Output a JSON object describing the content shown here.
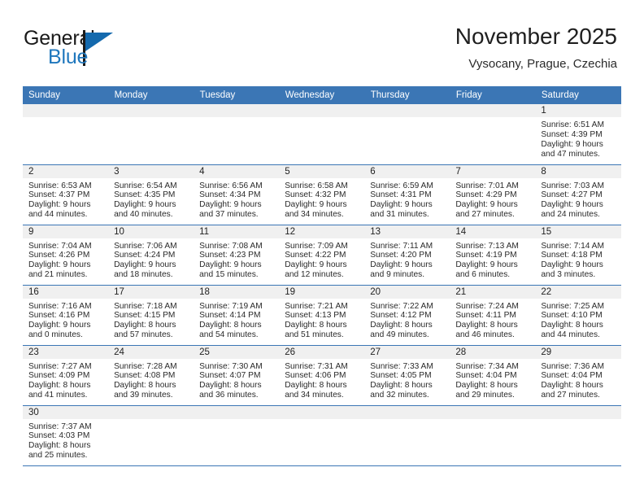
{
  "brand": {
    "name_top": "General",
    "name_bottom": "Blue",
    "accent_color": "#1469ad",
    "text_color": "#1a1a1a"
  },
  "header": {
    "title": "November 2025",
    "subtitle": "Vysocany, Prague, Czechia"
  },
  "calendar": {
    "header_bg": "#3b76b5",
    "daynum_bg": "#f0f0f0",
    "weekdays": [
      "Sunday",
      "Monday",
      "Tuesday",
      "Wednesday",
      "Thursday",
      "Friday",
      "Saturday"
    ],
    "weeks": [
      [
        {
          "day": "",
          "empty": true
        },
        {
          "day": "",
          "empty": true
        },
        {
          "day": "",
          "empty": true
        },
        {
          "day": "",
          "empty": true
        },
        {
          "day": "",
          "empty": true
        },
        {
          "day": "",
          "empty": true
        },
        {
          "day": "1",
          "sunrise": "Sunrise: 6:51 AM",
          "sunset": "Sunset: 4:39 PM",
          "daylight1": "Daylight: 9 hours",
          "daylight2": "and 47 minutes."
        }
      ],
      [
        {
          "day": "2",
          "sunrise": "Sunrise: 6:53 AM",
          "sunset": "Sunset: 4:37 PM",
          "daylight1": "Daylight: 9 hours",
          "daylight2": "and 44 minutes."
        },
        {
          "day": "3",
          "sunrise": "Sunrise: 6:54 AM",
          "sunset": "Sunset: 4:35 PM",
          "daylight1": "Daylight: 9 hours",
          "daylight2": "and 40 minutes."
        },
        {
          "day": "4",
          "sunrise": "Sunrise: 6:56 AM",
          "sunset": "Sunset: 4:34 PM",
          "daylight1": "Daylight: 9 hours",
          "daylight2": "and 37 minutes."
        },
        {
          "day": "5",
          "sunrise": "Sunrise: 6:58 AM",
          "sunset": "Sunset: 4:32 PM",
          "daylight1": "Daylight: 9 hours",
          "daylight2": "and 34 minutes."
        },
        {
          "day": "6",
          "sunrise": "Sunrise: 6:59 AM",
          "sunset": "Sunset: 4:31 PM",
          "daylight1": "Daylight: 9 hours",
          "daylight2": "and 31 minutes."
        },
        {
          "day": "7",
          "sunrise": "Sunrise: 7:01 AM",
          "sunset": "Sunset: 4:29 PM",
          "daylight1": "Daylight: 9 hours",
          "daylight2": "and 27 minutes."
        },
        {
          "day": "8",
          "sunrise": "Sunrise: 7:03 AM",
          "sunset": "Sunset: 4:27 PM",
          "daylight1": "Daylight: 9 hours",
          "daylight2": "and 24 minutes."
        }
      ],
      [
        {
          "day": "9",
          "sunrise": "Sunrise: 7:04 AM",
          "sunset": "Sunset: 4:26 PM",
          "daylight1": "Daylight: 9 hours",
          "daylight2": "and 21 minutes."
        },
        {
          "day": "10",
          "sunrise": "Sunrise: 7:06 AM",
          "sunset": "Sunset: 4:24 PM",
          "daylight1": "Daylight: 9 hours",
          "daylight2": "and 18 minutes."
        },
        {
          "day": "11",
          "sunrise": "Sunrise: 7:08 AM",
          "sunset": "Sunset: 4:23 PM",
          "daylight1": "Daylight: 9 hours",
          "daylight2": "and 15 minutes."
        },
        {
          "day": "12",
          "sunrise": "Sunrise: 7:09 AM",
          "sunset": "Sunset: 4:22 PM",
          "daylight1": "Daylight: 9 hours",
          "daylight2": "and 12 minutes."
        },
        {
          "day": "13",
          "sunrise": "Sunrise: 7:11 AM",
          "sunset": "Sunset: 4:20 PM",
          "daylight1": "Daylight: 9 hours",
          "daylight2": "and 9 minutes."
        },
        {
          "day": "14",
          "sunrise": "Sunrise: 7:13 AM",
          "sunset": "Sunset: 4:19 PM",
          "daylight1": "Daylight: 9 hours",
          "daylight2": "and 6 minutes."
        },
        {
          "day": "15",
          "sunrise": "Sunrise: 7:14 AM",
          "sunset": "Sunset: 4:18 PM",
          "daylight1": "Daylight: 9 hours",
          "daylight2": "and 3 minutes."
        }
      ],
      [
        {
          "day": "16",
          "sunrise": "Sunrise: 7:16 AM",
          "sunset": "Sunset: 4:16 PM",
          "daylight1": "Daylight: 9 hours",
          "daylight2": "and 0 minutes."
        },
        {
          "day": "17",
          "sunrise": "Sunrise: 7:18 AM",
          "sunset": "Sunset: 4:15 PM",
          "daylight1": "Daylight: 8 hours",
          "daylight2": "and 57 minutes."
        },
        {
          "day": "18",
          "sunrise": "Sunrise: 7:19 AM",
          "sunset": "Sunset: 4:14 PM",
          "daylight1": "Daylight: 8 hours",
          "daylight2": "and 54 minutes."
        },
        {
          "day": "19",
          "sunrise": "Sunrise: 7:21 AM",
          "sunset": "Sunset: 4:13 PM",
          "daylight1": "Daylight: 8 hours",
          "daylight2": "and 51 minutes."
        },
        {
          "day": "20",
          "sunrise": "Sunrise: 7:22 AM",
          "sunset": "Sunset: 4:12 PM",
          "daylight1": "Daylight: 8 hours",
          "daylight2": "and 49 minutes."
        },
        {
          "day": "21",
          "sunrise": "Sunrise: 7:24 AM",
          "sunset": "Sunset: 4:11 PM",
          "daylight1": "Daylight: 8 hours",
          "daylight2": "and 46 minutes."
        },
        {
          "day": "22",
          "sunrise": "Sunrise: 7:25 AM",
          "sunset": "Sunset: 4:10 PM",
          "daylight1": "Daylight: 8 hours",
          "daylight2": "and 44 minutes."
        }
      ],
      [
        {
          "day": "23",
          "sunrise": "Sunrise: 7:27 AM",
          "sunset": "Sunset: 4:09 PM",
          "daylight1": "Daylight: 8 hours",
          "daylight2": "and 41 minutes."
        },
        {
          "day": "24",
          "sunrise": "Sunrise: 7:28 AM",
          "sunset": "Sunset: 4:08 PM",
          "daylight1": "Daylight: 8 hours",
          "daylight2": "and 39 minutes."
        },
        {
          "day": "25",
          "sunrise": "Sunrise: 7:30 AM",
          "sunset": "Sunset: 4:07 PM",
          "daylight1": "Daylight: 8 hours",
          "daylight2": "and 36 minutes."
        },
        {
          "day": "26",
          "sunrise": "Sunrise: 7:31 AM",
          "sunset": "Sunset: 4:06 PM",
          "daylight1": "Daylight: 8 hours",
          "daylight2": "and 34 minutes."
        },
        {
          "day": "27",
          "sunrise": "Sunrise: 7:33 AM",
          "sunset": "Sunset: 4:05 PM",
          "daylight1": "Daylight: 8 hours",
          "daylight2": "and 32 minutes."
        },
        {
          "day": "28",
          "sunrise": "Sunrise: 7:34 AM",
          "sunset": "Sunset: 4:04 PM",
          "daylight1": "Daylight: 8 hours",
          "daylight2": "and 29 minutes."
        },
        {
          "day": "29",
          "sunrise": "Sunrise: 7:36 AM",
          "sunset": "Sunset: 4:04 PM",
          "daylight1": "Daylight: 8 hours",
          "daylight2": "and 27 minutes."
        }
      ],
      [
        {
          "day": "30",
          "sunrise": "Sunrise: 7:37 AM",
          "sunset": "Sunset: 4:03 PM",
          "daylight1": "Daylight: 8 hours",
          "daylight2": "and 25 minutes."
        },
        {
          "day": "",
          "empty": true
        },
        {
          "day": "",
          "empty": true
        },
        {
          "day": "",
          "empty": true
        },
        {
          "day": "",
          "empty": true
        },
        {
          "day": "",
          "empty": true
        },
        {
          "day": "",
          "empty": true
        }
      ]
    ]
  }
}
